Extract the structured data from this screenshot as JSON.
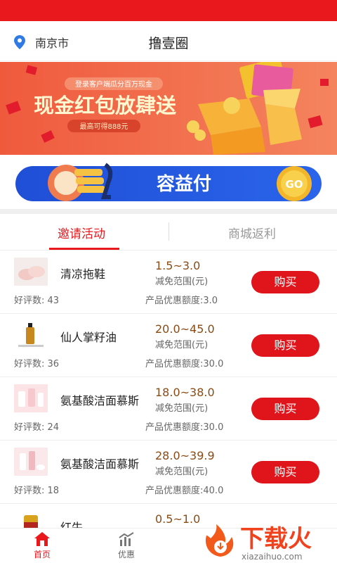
{
  "header": {
    "city": "南京市",
    "title": "撸壹圈"
  },
  "banner": {
    "subtitle": "登录客户端瓜分百万现金",
    "headline": "现金红包放肆送",
    "note": "最高可得888元",
    "slide_index": 2,
    "slide_count": 3
  },
  "pay_banner": {
    "text": "容益付",
    "button": "GO"
  },
  "tabs": [
    {
      "label": "邀请活动",
      "active": true
    },
    {
      "label": "商城返利",
      "active": false
    }
  ],
  "labels": {
    "good_prefix": "好评数: ",
    "range_label": "减免范围(元)",
    "quota_prefix": "产品优惠额度:",
    "buy": "购买"
  },
  "products": [
    {
      "name": "清凉拖鞋",
      "good_reviews": "43",
      "range": "1.5~3.0",
      "quota": "3.0"
    },
    {
      "name": "仙人掌籽油",
      "good_reviews": "36",
      "range": "20.0~45.0",
      "quota": "30.0"
    },
    {
      "name": "氨基酸洁面慕斯",
      "good_reviews": "24",
      "range": "18.0~38.0",
      "quota": "30.0"
    },
    {
      "name": "氨基酸洁面慕斯",
      "good_reviews": "18",
      "range": "28.0~39.9",
      "quota": "40.0"
    },
    {
      "name": "红牛",
      "good_reviews": "",
      "range": "0.5~1.0",
      "quota": ""
    }
  ],
  "nav": [
    {
      "label": "首页",
      "active": true
    },
    {
      "label": "优惠",
      "active": false
    }
  ],
  "watermark": {
    "brand": "下载火",
    "url": "xiazaihuo.com"
  },
  "colors": {
    "primary": "#e8181d",
    "price": "#8a4b15"
  }
}
